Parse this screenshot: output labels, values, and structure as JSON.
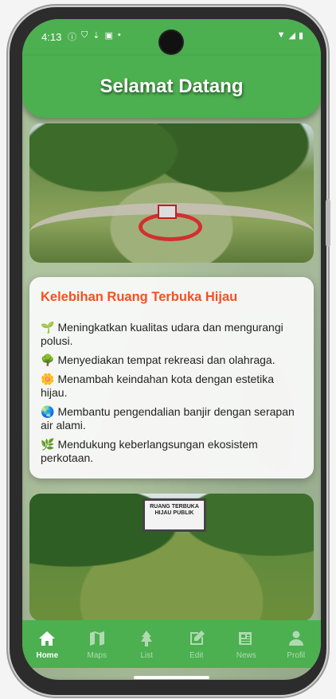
{
  "status_bar": {
    "time": "4:13",
    "icons": [
      "info-icon",
      "shield-icon",
      "download-icon",
      "text-icon",
      "dot-icon"
    ],
    "right_icons": [
      "wifi-icon",
      "signal-icon",
      "battery-icon"
    ]
  },
  "header": {
    "title": "Selamat Datang"
  },
  "card": {
    "title": "Kelebihan Ruang Terbuka Hijau",
    "items": [
      {
        "emoji": "🌱",
        "text": "Meningkatkan kualitas udara dan mengurangi polusi."
      },
      {
        "emoji": "🌳",
        "text": "Menyediakan tempat rekreasi dan olahraga."
      },
      {
        "emoji": "🌼",
        "text": "Menambah keindahan kota dengan estetika hijau."
      },
      {
        "emoji": "🌏",
        "text": "Membantu pengendalian banjir dengan serapan air alami."
      },
      {
        "emoji": "🌿",
        "text": "Mendukung keberlangsungan ekosistem perkotaan."
      }
    ]
  },
  "photo2": {
    "sign_line1": "RUANG TERBUKA",
    "sign_line2": "HIJAU PUBLIK"
  },
  "nav": {
    "items": [
      {
        "label": "Home",
        "icon": "home-icon",
        "active": true
      },
      {
        "label": "Maps",
        "icon": "map-icon",
        "active": false
      },
      {
        "label": "List",
        "icon": "tree-icon",
        "active": false
      },
      {
        "label": "Edit",
        "icon": "edit-icon",
        "active": false
      },
      {
        "label": "News",
        "icon": "newspaper-icon",
        "active": false
      },
      {
        "label": "Profil",
        "icon": "person-icon",
        "active": false
      }
    ]
  },
  "colors": {
    "primary": "#4caf50",
    "accent": "#f4511e"
  }
}
